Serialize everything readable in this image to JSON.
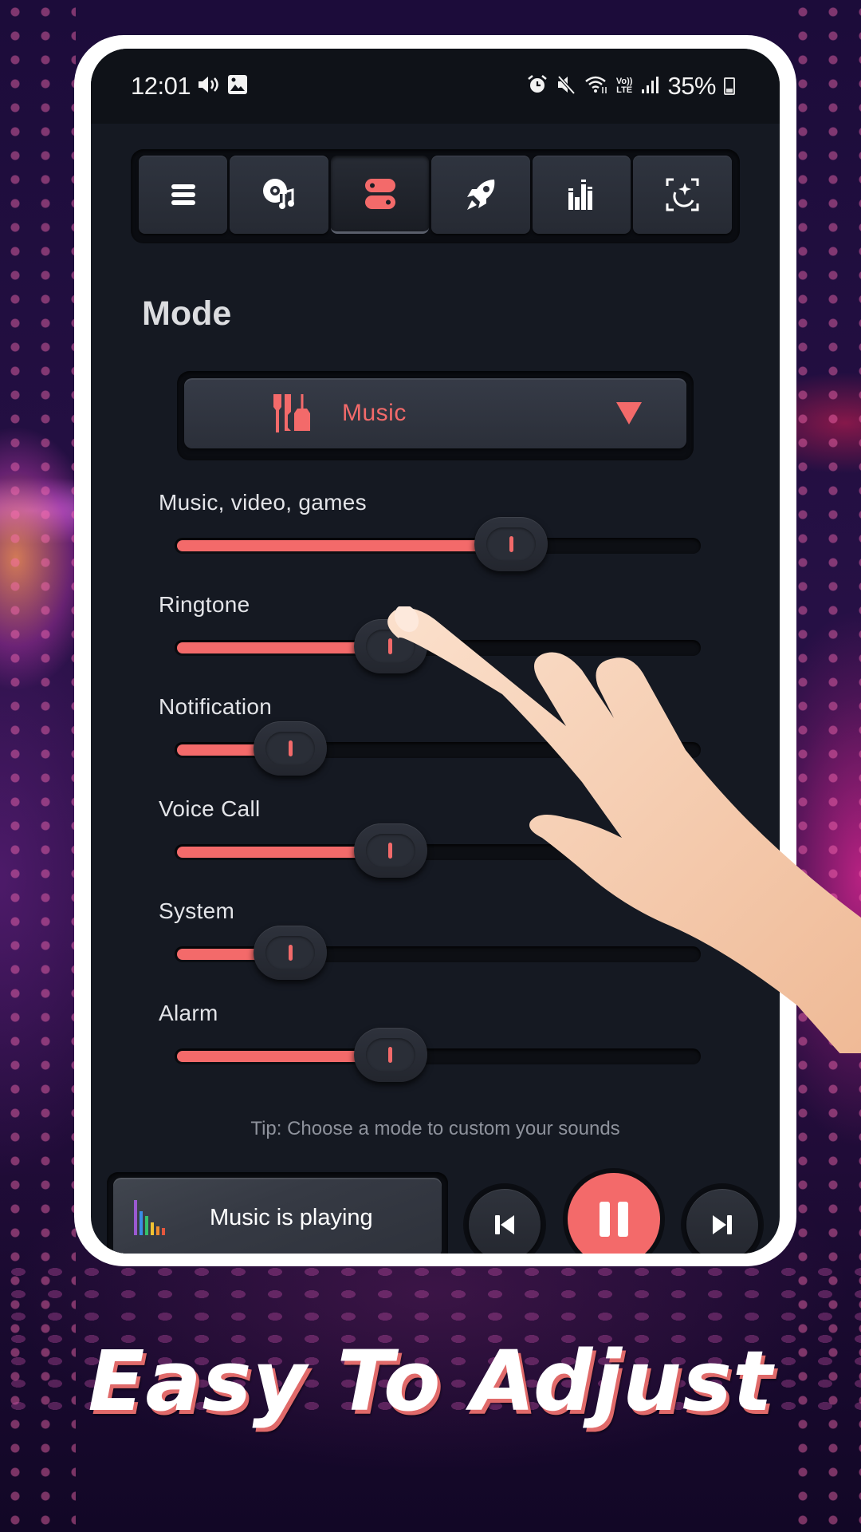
{
  "status_bar": {
    "time": "12:01",
    "battery_percent": "35%",
    "left_icons": [
      "volume-icon",
      "gallery-icon"
    ],
    "right_icons": [
      "alarm-icon",
      "mute-icon",
      "wifi-icon",
      "volte-lte-icon",
      "signal-icon",
      "battery-charging-icon"
    ],
    "lte_top": "Vo))",
    "lte_bottom": "LTE"
  },
  "tabs": [
    {
      "icon": "menu-icon",
      "active": false
    },
    {
      "icon": "music-disc-icon",
      "active": false
    },
    {
      "icon": "toggle-mode-icon",
      "active": true
    },
    {
      "icon": "rocket-boost-icon",
      "active": false
    },
    {
      "icon": "equalizer-icon",
      "active": false
    },
    {
      "icon": "sparkle-scan-icon",
      "active": false
    }
  ],
  "mode": {
    "title": "Mode",
    "selected": "Music",
    "selected_icon": "earphones-icon"
  },
  "sliders": [
    {
      "label": "Music, video, games",
      "value_percent": 64
    },
    {
      "label": "Ringtone",
      "value_percent": 41
    },
    {
      "label": "Notification",
      "value_percent": 22
    },
    {
      "label": "Voice Call",
      "value_percent": 41
    },
    {
      "label": "System",
      "value_percent": 22
    },
    {
      "label": "Alarm",
      "value_percent": 41
    }
  ],
  "tip": "Tip: Choose a mode to custom your sounds",
  "player": {
    "status": "Music is playing",
    "bar_colors": [
      "#9b59d0",
      "#3a8ee6",
      "#34c16b",
      "#f1c232",
      "#f08a2e",
      "#e4573d"
    ],
    "controls": [
      "previous",
      "pause",
      "next"
    ]
  },
  "colors": {
    "accent": "#f36a6a",
    "screen_bg": "#151922",
    "frame": "#ffffff"
  },
  "headline": "Easy To Adjust"
}
